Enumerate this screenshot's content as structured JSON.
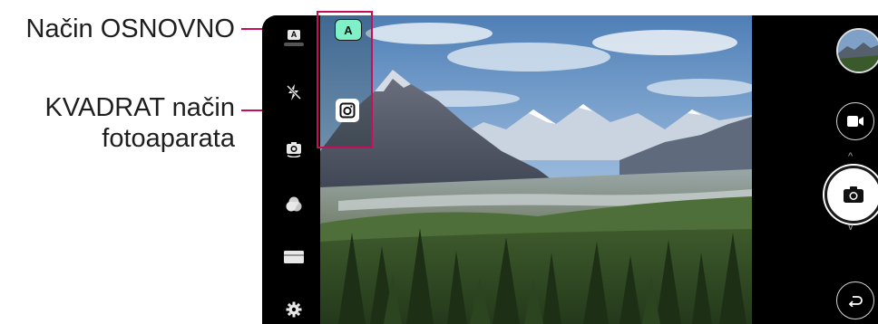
{
  "callouts": {
    "basic_mode": "Način OSNOVNO",
    "square_mode_line1": "KVADRAT način",
    "square_mode_line2": "fotoaparata"
  },
  "camera": {
    "left_toolbar": {
      "mode_badge": "A",
      "items": [
        "mode-indicator-icon",
        "flash-off-icon",
        "switch-camera-icon",
        "filter-icon",
        "ratio-icon",
        "settings-icon"
      ]
    },
    "mode_strip": {
      "auto_mode_label": "A",
      "items": [
        "auto-mode-icon",
        "square-camera-icon"
      ]
    },
    "right_controls": [
      "gallery-thumbnail",
      "video-record-icon",
      "shutter-camera-icon",
      "back-icon"
    ]
  },
  "colors": {
    "callout_accent": "#c3105a",
    "auto_mode_bg": "#7ff0c8"
  }
}
